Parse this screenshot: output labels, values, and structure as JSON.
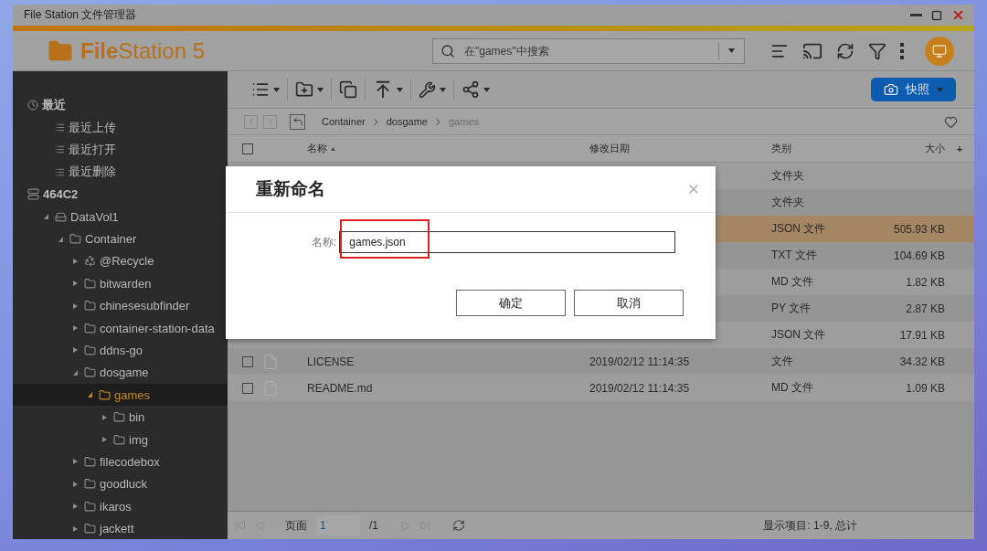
{
  "window": {
    "title": "File Station 文件管理器"
  },
  "window_controls": [
    {
      "kind": "minimize"
    },
    {
      "kind": "maximize"
    },
    {
      "kind": "close"
    }
  ],
  "app": {
    "name": "**File**Station 5"
  },
  "search": {
    "placeholder": "在\"games\"中搜索"
  },
  "header_actions": [
    {
      "kind": "queue"
    },
    {
      "kind": "cast"
    },
    {
      "kind": "refresh"
    },
    {
      "kind": "filter"
    },
    {
      "kind": "more"
    },
    {
      "kind": "remote"
    }
  ],
  "toolbar": [
    {
      "kind": "view",
      "menu": true
    },
    {
      "kind": "new-folder",
      "menu": true
    },
    {
      "kind": "copy",
      "menu": false
    },
    {
      "kind": "upload",
      "menu": true
    },
    {
      "kind": "tools",
      "menu": true
    },
    {
      "kind": "share",
      "menu": true
    }
  ],
  "snapshot_button": {
    "label": "快照"
  },
  "breadcrumb": [
    "Container",
    "dosgame",
    "games"
  ],
  "sidebar": {
    "items": [
      {
        "label": "最近",
        "kind": "clock",
        "selected": false,
        "children": [
          {
            "label": "最近上传",
            "kind": "list",
            "selected": false
          },
          {
            "label": "最近打开",
            "kind": "list",
            "selected": false
          },
          {
            "label": "最近删除",
            "kind": "list",
            "selected": false
          }
        ]
      },
      {
        "label": "464C2",
        "kind": "nas",
        "selected": false,
        "children": [
          {
            "label": "DataVol1",
            "kind": "drive",
            "expanded": true,
            "selected": false,
            "children": [
              {
                "label": "Container",
                "kind": "folder",
                "expanded": true,
                "selected": false,
                "children": [
                  {
                    "label": "@Recycle",
                    "kind": "recycle",
                    "expanded": false,
                    "selected": false
                  },
                  {
                    "label": "bitwarden",
                    "kind": "folder",
                    "expanded": false,
                    "selected": false
                  },
                  {
                    "label": "chinesesubfinder",
                    "kind": "folder",
                    "expanded": false,
                    "selected": false
                  },
                  {
                    "label": "container-station-data",
                    "kind": "folder",
                    "expanded": false,
                    "selected": false
                  },
                  {
                    "label": "ddns-go",
                    "kind": "folder",
                    "expanded": false,
                    "selected": false
                  },
                  {
                    "label": "dosgame",
                    "kind": "folder",
                    "expanded": true,
                    "selected": false,
                    "children": [
                      {
                        "label": "games",
                        "kind": "folder",
                        "expanded": true,
                        "selected": true,
                        "children": [
                          {
                            "label": "bin",
                            "kind": "folder",
                            "expanded": false,
                            "selected": false
                          },
                          {
                            "label": "img",
                            "kind": "folder",
                            "expanded": false,
                            "selected": false
                          }
                        ]
                      }
                    ]
                  },
                  {
                    "label": "filecodebox",
                    "kind": "folder",
                    "expanded": false,
                    "selected": false
                  },
                  {
                    "label": "goodluck",
                    "kind": "folder",
                    "expanded": false,
                    "selected": false
                  },
                  {
                    "label": "ikaros",
                    "kind": "folder",
                    "expanded": false,
                    "selected": false
                  },
                  {
                    "label": "jackett",
                    "kind": "folder",
                    "expanded": false,
                    "selected": false
                  }
                ]
              }
            ]
          }
        ]
      }
    ]
  },
  "table": {
    "select_all_checked": false,
    "add_column": "+",
    "columns": [
      {
        "label": "名称",
        "sort_mark": "▲"
      },
      {
        "label": "修改日期"
      },
      {
        "label": "类别"
      },
      {
        "label": "大小"
      }
    ],
    "rows": [
      {
        "type": "文件夹",
        "size": "",
        "selected": false
      },
      {
        "type": "文件夹",
        "size": "",
        "selected": false
      },
      {
        "type": "JSON 文件",
        "size": "505.93 KB",
        "selected": true
      },
      {
        "type": "TXT 文件",
        "size": "104.69 KB",
        "selected": false
      },
      {
        "type": "MD 文件",
        "size": "1.82 KB",
        "selected": false
      },
      {
        "type": "PY 文件",
        "size": "2.87 KB",
        "selected": false
      },
      {
        "type": "JSON 文件",
        "size": "17.91 KB",
        "selected": false
      },
      {
        "name": "LICENSE",
        "date": "2019/02/12 11:14:35",
        "type": "文件",
        "size": "34.32 KB",
        "checked": false,
        "selected": false
      },
      {
        "name": "README.md",
        "date": "2019/02/12 11:14:35",
        "type": "MD 文件",
        "size": "1.09 KB",
        "checked": false,
        "selected": false
      }
    ]
  },
  "footer": {
    "page_label": "页面",
    "page": "1",
    "page_total": "/1",
    "status": "显示项目: 1-9, 总计"
  },
  "dialog": {
    "title": "重新命名",
    "field_label": "名称:",
    "value": "games.json",
    "highlight": true,
    "buttons": [
      "确定",
      "取消"
    ]
  }
}
